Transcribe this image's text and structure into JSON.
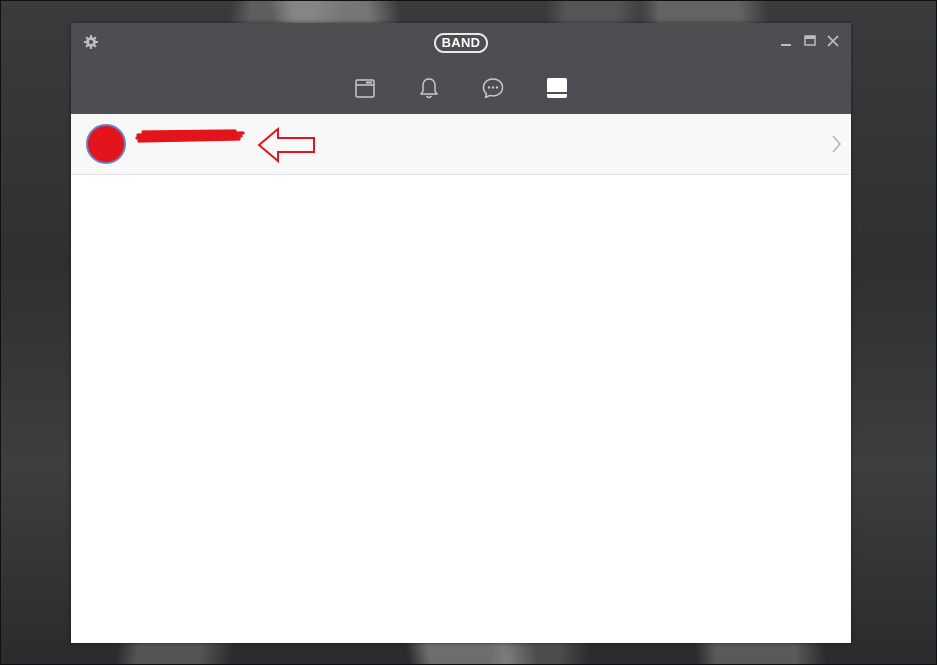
{
  "app": {
    "logo_text": "BAND"
  },
  "titlebar": {
    "icons": [
      "gear-icon",
      "minimize-icon",
      "maximize-icon",
      "close-icon"
    ]
  },
  "tabs": [
    {
      "icon": "home-feed-icon",
      "active": false
    },
    {
      "icon": "bell-icon",
      "active": false
    },
    {
      "icon": "chat-bubble-icon",
      "active": false
    },
    {
      "icon": "profile-tab-icon",
      "active": true
    }
  ],
  "profile_row": {
    "name": "",
    "avatar_color": "#e3141b",
    "chevron_icon": "chevron-right-icon",
    "annotation": "left-arrow-annotation"
  },
  "colors": {
    "chrome": "#4d4d52",
    "icon": "#c9c9cc",
    "active_icon": "#ffffff",
    "annotation_red": "#e3141b"
  }
}
